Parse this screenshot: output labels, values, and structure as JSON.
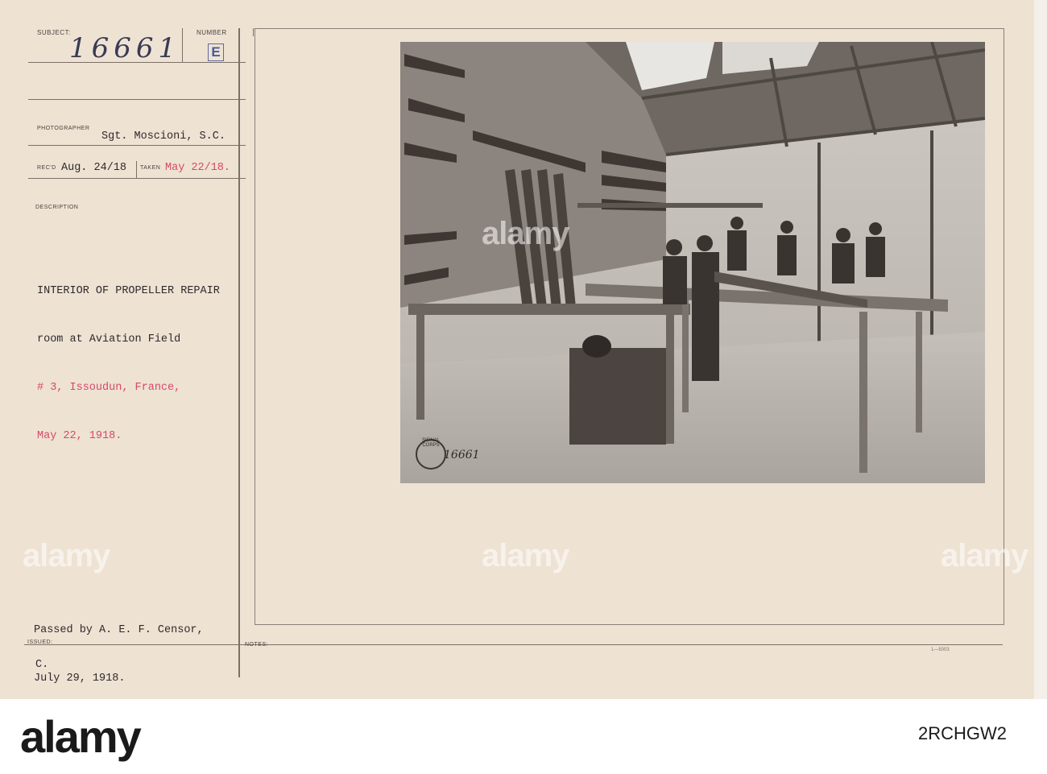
{
  "card": {
    "labels": {
      "subject": "SUBJECT:",
      "number": "NUMBER",
      "photographer": "PHOTOGRAPHER",
      "recd": "REC'D",
      "taken": "TAKEN",
      "description": "DESCRIPTION",
      "issued": "ISSUED:",
      "notes": "NOTES:"
    },
    "subject_handwritten": "16661",
    "number_stamp": "E",
    "photographer_name": "Sgt. Moscioni, S.C.",
    "received_date": "Aug. 24/18",
    "taken_date": "May 22/18.",
    "description_lines": [
      "INTERIOR OF PROPELLER REPAIR",
      "room at Aviation Field",
      "# 3, Issoudun, France,",
      "May 22, 1918."
    ],
    "censor_lines": [
      "Passed by A. E. F. Censor,",
      "July 29, 1918."
    ],
    "issued_value": "C.",
    "form_number": "1—5003"
  },
  "photo": {
    "stamp_text": "SIGNAL CORPS",
    "negative_number": "16661"
  },
  "watermark": {
    "text": "alamy",
    "id": "2RCHGW2"
  },
  "colors": {
    "card": "#eee2d3",
    "typed_red": "#d8486b",
    "typed_black": "#2e2a2c"
  }
}
